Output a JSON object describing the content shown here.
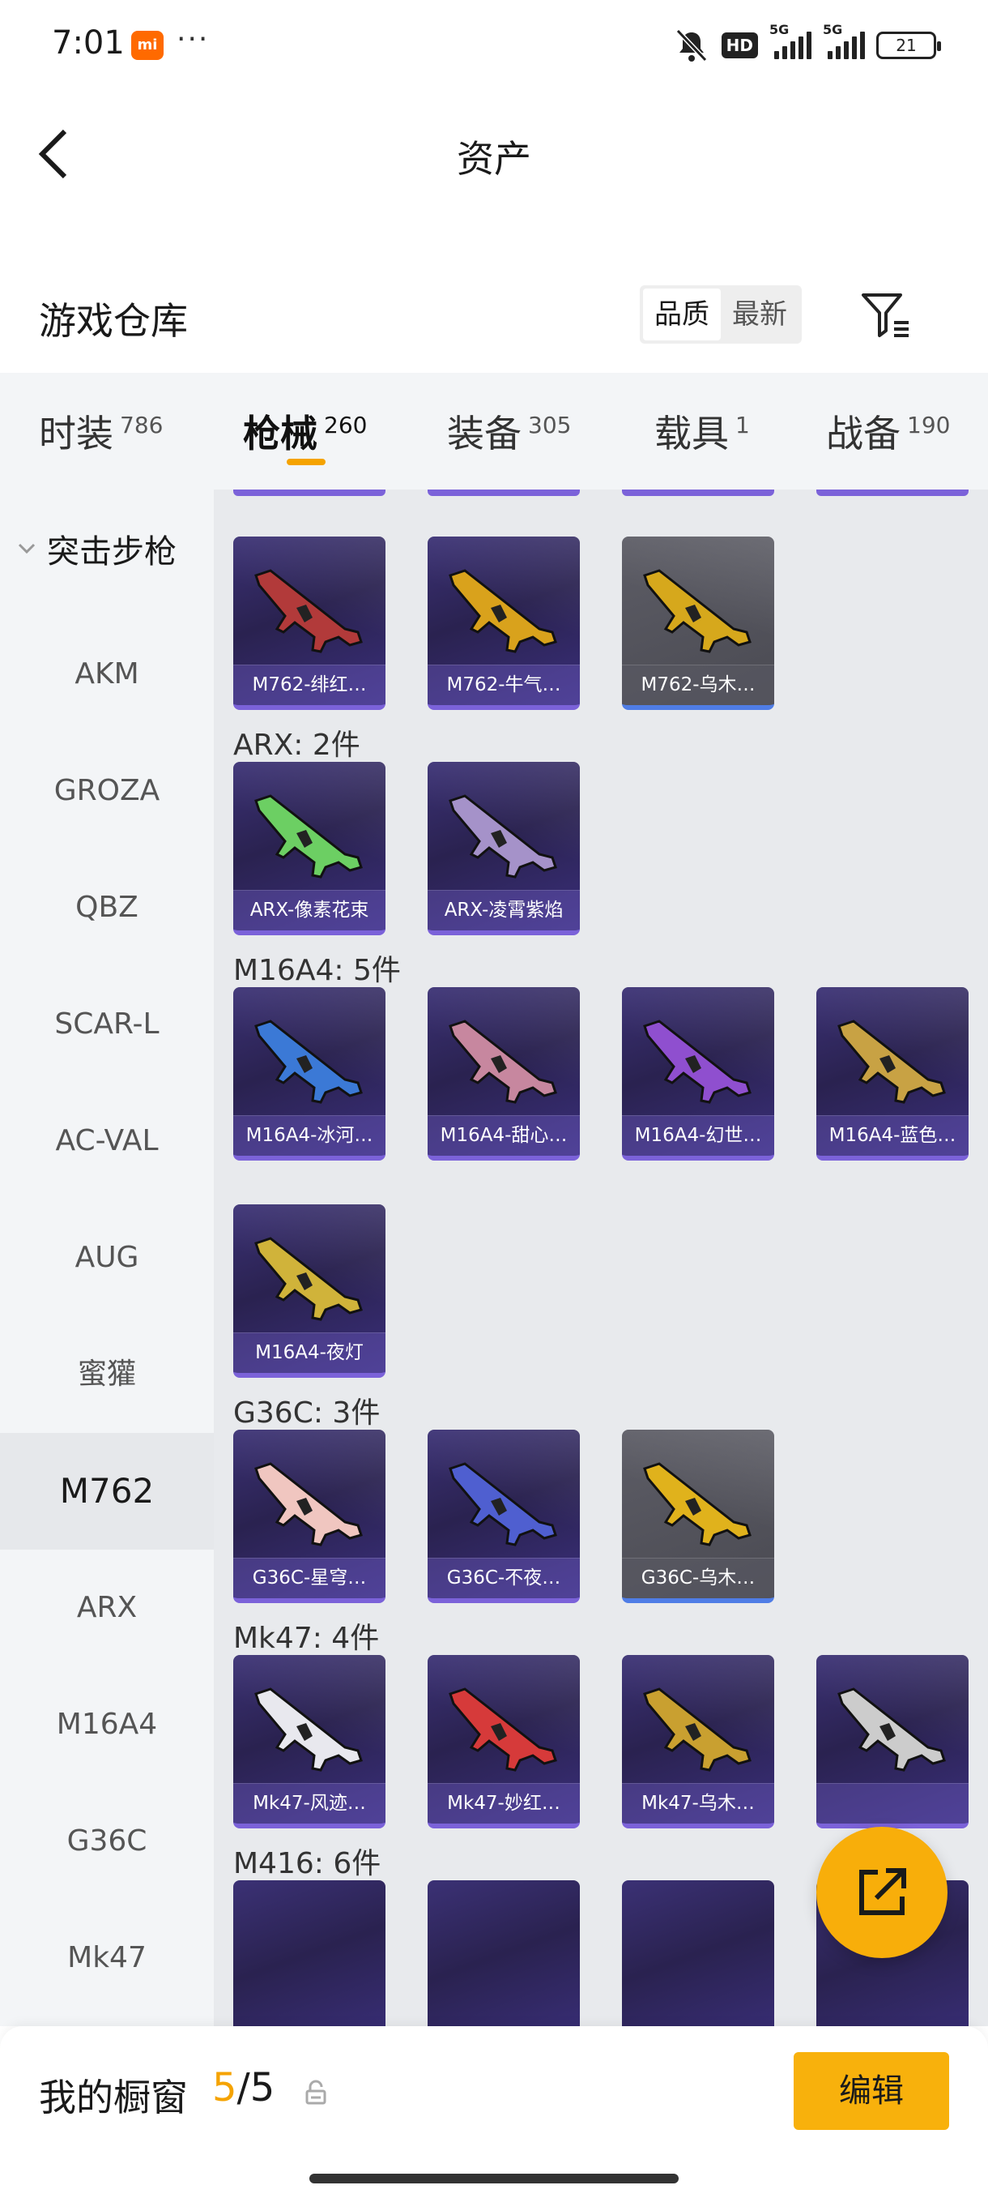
{
  "status_bar": {
    "time": "7:01",
    "mi_badge": "mi",
    "dots": "···",
    "hd_label": "HD",
    "signal1_label": "5G",
    "signal2_label": "5G",
    "battery": "21"
  },
  "nav": {
    "title": "资产"
  },
  "section": {
    "title": "游戏仓库",
    "sort_options": [
      "品质",
      "最新"
    ],
    "sort_selected": "品质"
  },
  "tabs": [
    {
      "label": "时装",
      "count": "786"
    },
    {
      "label": "枪械",
      "count": "260",
      "active": true
    },
    {
      "label": "装备",
      "count": "305"
    },
    {
      "label": "载具",
      "count": "1"
    },
    {
      "label": "战备",
      "count": "190"
    }
  ],
  "sidebar": {
    "category": "突击步枪",
    "items": [
      "AKM",
      "GROZA",
      "QBZ",
      "SCAR-L",
      "AC-VAL",
      "AUG",
      "蜜獾",
      "M762",
      "ARX",
      "M16A4",
      "G36C",
      "Mk47"
    ],
    "selected": "M762"
  },
  "groups": [
    {
      "title": "",
      "items": [
        {
          "name": "M762-绯红…",
          "style": "purple",
          "gun_color": "#b23a3a"
        },
        {
          "name": "M762-牛气…",
          "style": "purple",
          "gun_color": "#d9a21c"
        },
        {
          "name": "M762-乌木…",
          "style": "grey",
          "gun_color": "#d6a81c"
        }
      ]
    },
    {
      "title": "ARX: 2件",
      "items": [
        {
          "name": "ARX-像素花束",
          "style": "purple",
          "gun_color": "#6ccf63"
        },
        {
          "name": "ARX-凌霄紫焰",
          "style": "purple",
          "gun_color": "#a592c9"
        }
      ]
    },
    {
      "title": "M16A4: 5件",
      "items": [
        {
          "name": "M16A4-冰河…",
          "style": "purple",
          "gun_color": "#3b79d6"
        },
        {
          "name": "M16A4-甜心…",
          "style": "purple",
          "gun_color": "#c7879f"
        },
        {
          "name": "M16A4-幻世…",
          "style": "purple",
          "gun_color": "#8f4fcf"
        },
        {
          "name": "M16A4-蓝色…",
          "style": "purple",
          "gun_color": "#c8a244"
        },
        {
          "name": "M16A4-夜灯",
          "style": "purple",
          "gun_color": "#d0b33a"
        }
      ]
    },
    {
      "title": "G36C: 3件",
      "items": [
        {
          "name": "G36C-星穹…",
          "style": "purple",
          "gun_color": "#f0c6c0"
        },
        {
          "name": "G36C-不夜…",
          "style": "purple",
          "gun_color": "#4f5fd0"
        },
        {
          "name": "G36C-乌木…",
          "style": "grey",
          "gun_color": "#e0b21c"
        }
      ]
    },
    {
      "title": "Mk47: 4件",
      "items": [
        {
          "name": "Mk47-风迹…",
          "style": "purple",
          "gun_color": "#e8e8ee"
        },
        {
          "name": "Mk47-妙红…",
          "style": "purple",
          "gun_color": "#d63a3a"
        },
        {
          "name": "Mk47-乌木…",
          "style": "purple",
          "gun_color": "#c9a030"
        },
        {
          "name": "",
          "style": "purple",
          "gun_color": "#cccccc"
        }
      ]
    },
    {
      "title": "M416: 6件",
      "items": []
    }
  ],
  "bottom": {
    "title": "我的橱窗",
    "current": "5",
    "separator": "/",
    "total": "5",
    "edit_label": "编辑"
  },
  "colors": {
    "accent": "#f5a300",
    "card_purple": "#2a2250",
    "card_grey": "#4a4a52"
  }
}
